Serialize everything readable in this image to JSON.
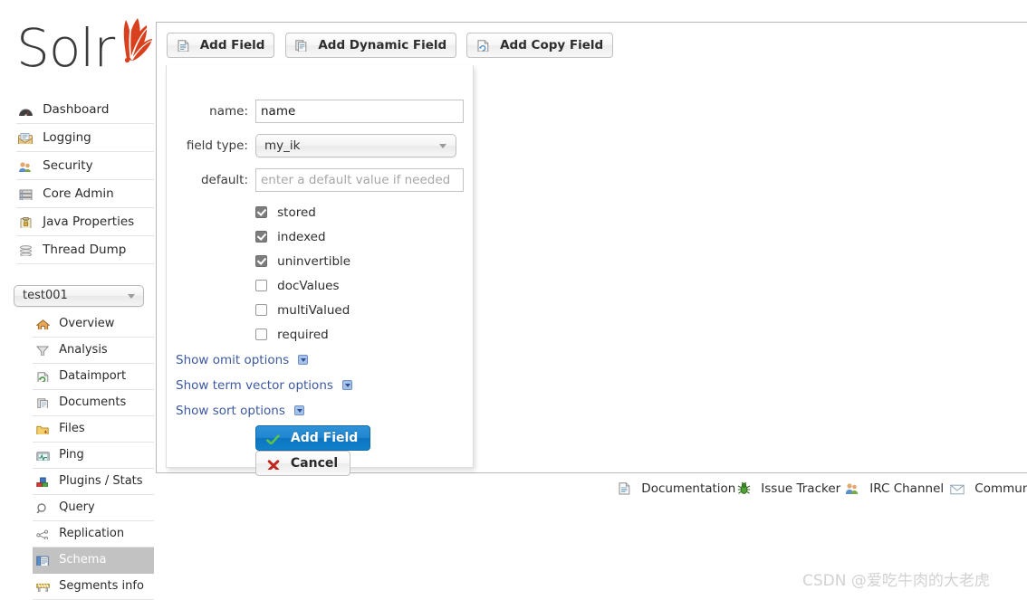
{
  "brand": {
    "name": "Solr",
    "logo_icon": "solr-burst-logo"
  },
  "sidebar": {
    "main_nav": [
      {
        "label": "Dashboard",
        "icon": "dashboard-icon"
      },
      {
        "label": "Logging",
        "icon": "logging-icon"
      },
      {
        "label": "Security",
        "icon": "security-icon"
      },
      {
        "label": "Core Admin",
        "icon": "core-admin-icon"
      },
      {
        "label": "Java Properties",
        "icon": "java-properties-icon"
      },
      {
        "label": "Thread Dump",
        "icon": "thread-dump-icon"
      }
    ],
    "core_selector": {
      "selected": "test001",
      "caret_icon": "chevron-down-icon"
    },
    "core_nav": [
      {
        "label": "Overview",
        "icon": "overview-home-icon",
        "active": false
      },
      {
        "label": "Analysis",
        "icon": "analysis-funnel-icon",
        "active": false
      },
      {
        "label": "Dataimport",
        "icon": "dataimport-icon",
        "active": false
      },
      {
        "label": "Documents",
        "icon": "documents-icon",
        "active": false
      },
      {
        "label": "Files",
        "icon": "files-folder-icon",
        "active": false
      },
      {
        "label": "Ping",
        "icon": "ping-icon",
        "active": false
      },
      {
        "label": "Plugins / Stats",
        "icon": "plugins-stats-icon",
        "active": false
      },
      {
        "label": "Query",
        "icon": "query-magnifier-icon",
        "active": false
      },
      {
        "label": "Replication",
        "icon": "replication-icon",
        "active": false
      },
      {
        "label": "Schema",
        "icon": "schema-book-icon",
        "active": true
      },
      {
        "label": "Segments info",
        "icon": "segments-info-icon",
        "active": false
      }
    ]
  },
  "toolbar": {
    "buttons": [
      {
        "label": "Add Field",
        "icon": "add-field-icon"
      },
      {
        "label": "Add Dynamic Field",
        "icon": "add-dynamic-field-icon"
      },
      {
        "label": "Add Copy Field",
        "icon": "add-copy-field-icon"
      }
    ]
  },
  "form": {
    "name_label": "name:",
    "name_value": "name",
    "field_type_label": "field type:",
    "field_type_value": "my_ik",
    "field_type_caret_icon": "chevron-down-icon",
    "default_label": "default:",
    "default_value": "",
    "default_placeholder": "enter a default value if needed",
    "checkboxes": [
      {
        "label": "stored",
        "checked": true
      },
      {
        "label": "indexed",
        "checked": true
      },
      {
        "label": "uninvertible",
        "checked": true
      },
      {
        "label": "docValues",
        "checked": false
      },
      {
        "label": "multiValued",
        "checked": false
      },
      {
        "label": "required",
        "checked": false
      }
    ],
    "show_options": [
      {
        "label": "Show omit options",
        "icon": "expand-toggle-icon"
      },
      {
        "label": "Show term vector options",
        "icon": "expand-toggle-icon"
      },
      {
        "label": "Show sort options",
        "icon": "expand-toggle-icon"
      }
    ],
    "submit_label": "Add Field",
    "submit_icon": "green-check-icon",
    "cancel_label": "Cancel",
    "cancel_icon": "red-x-icon"
  },
  "footer": {
    "links": [
      {
        "label": "Documentation",
        "icon": "documentation-icon"
      },
      {
        "label": "Issue Tracker",
        "icon": "bug-icon"
      },
      {
        "label": "IRC Channel",
        "icon": "irc-people-icon"
      },
      {
        "label": "Community",
        "icon": "mail-envelope-icon"
      }
    ]
  },
  "watermark": {
    "text": "CSDN @爱吃牛肉的大老虎"
  },
  "colors": {
    "accent_blue": "#1081cc",
    "link_blue": "#3d5a9e",
    "active_nav_bg": "#c2c2c2",
    "logo_red": "#d9411e"
  }
}
